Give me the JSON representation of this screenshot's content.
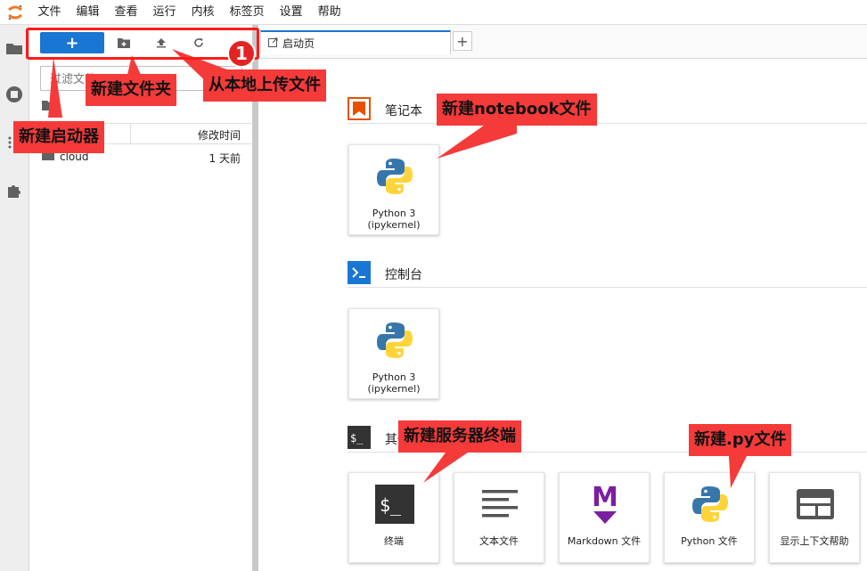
{
  "menubar": {
    "items": [
      "文件",
      "编辑",
      "查看",
      "运行",
      "内核",
      "标签页",
      "设置",
      "帮助"
    ]
  },
  "filebrowser": {
    "launcher_label": "+",
    "filter_placeholder": "过滤文件",
    "columns": {
      "name": "名称",
      "modified": "修改时间"
    },
    "rows": [
      {
        "name": "cloud",
        "modified": "1 天前"
      }
    ]
  },
  "tabs": {
    "active": "启动页",
    "add": "+"
  },
  "launcher": {
    "notebook": {
      "title": "笔记本",
      "cards": [
        {
          "label": "Python 3 (ipykernel)"
        }
      ]
    },
    "console": {
      "title": "控制台",
      "cards": [
        {
          "label": "Python 3 (ipykernel)"
        }
      ]
    },
    "other": {
      "title": "其他",
      "cards": [
        {
          "label": "终端"
        },
        {
          "label": "文本文件"
        },
        {
          "label": "Markdown 文件"
        },
        {
          "label": "Python 文件"
        },
        {
          "label": "显示上下文帮助"
        }
      ]
    }
  },
  "annotations": {
    "badge": "1",
    "new_folder": "新建文件夹",
    "upload": "从本地上传文件",
    "new_launcher": "新建启动器",
    "new_notebook": "新建notebook文件",
    "new_terminal": "新建服务器终端",
    "new_py": "新建.py文件"
  },
  "colors": {
    "accent": "#1976d2",
    "annotation": "#f53a3a",
    "annotation_border": "#ff1a1a"
  }
}
